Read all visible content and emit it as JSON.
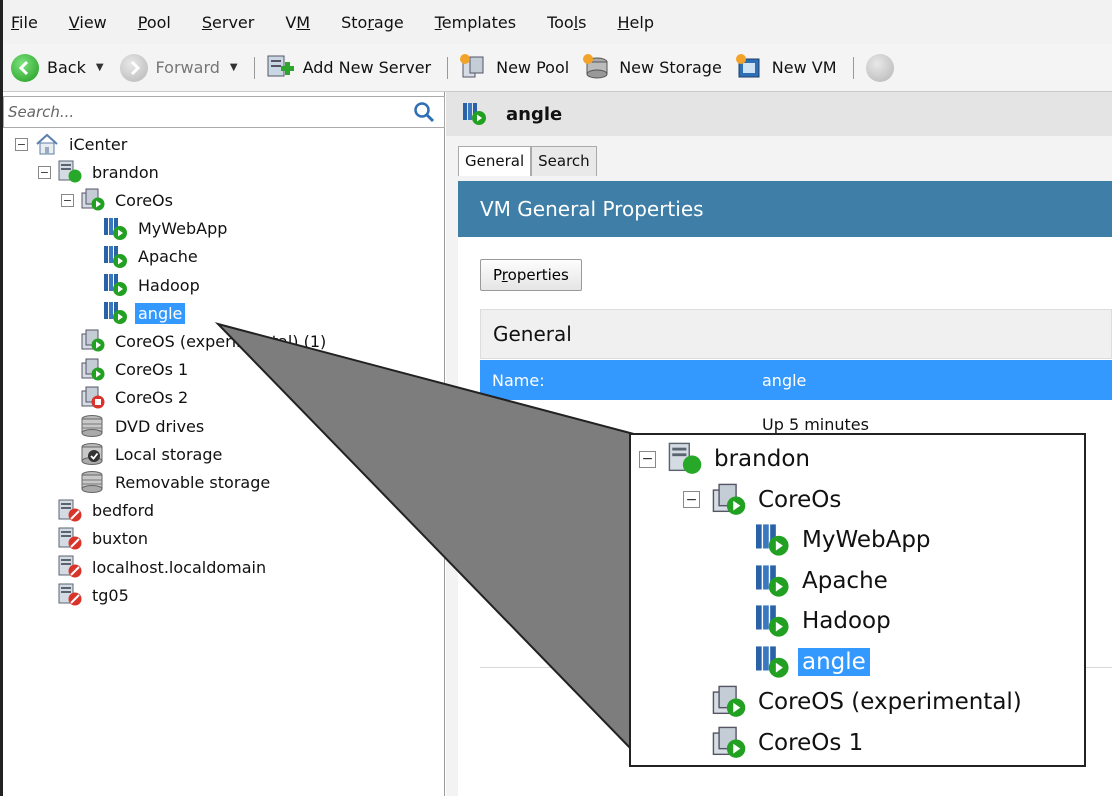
{
  "menu": [
    {
      "pre": "",
      "u": "F",
      "post": "ile"
    },
    {
      "pre": "",
      "u": "V",
      "post": "iew"
    },
    {
      "pre": "",
      "u": "P",
      "post": "ool"
    },
    {
      "pre": "",
      "u": "S",
      "post": "erver"
    },
    {
      "pre": "V",
      "u": "M",
      "post": ""
    },
    {
      "pre": "Sto",
      "u": "r",
      "post": "age"
    },
    {
      "pre": "",
      "u": "T",
      "post": "emplates"
    },
    {
      "pre": "Too",
      "u": "l",
      "post": "s"
    },
    {
      "pre": "",
      "u": "H",
      "post": "elp"
    }
  ],
  "toolbar": {
    "back": "Back",
    "forward": "Forward",
    "add_server": "Add New Server",
    "new_pool": "New Pool",
    "new_storage": "New Storage",
    "new_vm": "New VM"
  },
  "search": {
    "placeholder": "Search..."
  },
  "tree": [
    {
      "label": "iCenter",
      "level": 0,
      "exp": "−",
      "icon": "home-icon"
    },
    {
      "label": "brandon",
      "level": 1,
      "exp": "−",
      "icon": "server-running-icon"
    },
    {
      "label": "CoreOs",
      "level": 2,
      "exp": "−",
      "icon": "pool-running-icon"
    },
    {
      "label": "MyWebApp",
      "level": 3,
      "exp": "",
      "icon": "vm-running-icon"
    },
    {
      "label": "Apache",
      "level": 3,
      "exp": "",
      "icon": "vm-running-icon"
    },
    {
      "label": "Hadoop",
      "level": 3,
      "exp": "",
      "icon": "vm-running-icon"
    },
    {
      "label": "angle",
      "level": 3,
      "exp": "",
      "icon": "vm-running-icon",
      "selected": true
    },
    {
      "label": "CoreOS (experimental) (1)",
      "level": 2,
      "exp": "",
      "icon": "pool-running-icon"
    },
    {
      "label": "CoreOs 1",
      "level": 2,
      "exp": "",
      "icon": "pool-running-icon"
    },
    {
      "label": "CoreOs 2",
      "level": 2,
      "exp": "",
      "icon": "pool-stopped-icon"
    },
    {
      "label": "DVD drives",
      "level": 2,
      "exp": "",
      "icon": "storage-icon"
    },
    {
      "label": "Local storage",
      "level": 2,
      "exp": "",
      "icon": "local-storage-icon"
    },
    {
      "label": "Removable storage",
      "level": 2,
      "exp": "",
      "icon": "storage-icon"
    },
    {
      "label": "bedford",
      "level": 1,
      "exp": "",
      "icon": "server-disconnected-icon"
    },
    {
      "label": "buxton",
      "level": 1,
      "exp": "",
      "icon": "server-disconnected-icon"
    },
    {
      "label": "localhost.localdomain",
      "level": 1,
      "exp": "",
      "icon": "server-disconnected-icon"
    },
    {
      "label": "tg05",
      "level": 1,
      "exp": "",
      "icon": "server-disconnected-icon"
    }
  ],
  "header": {
    "title": "angle"
  },
  "tabs": [
    "General",
    "Search"
  ],
  "banner": "VM General Properties",
  "properties_button": {
    "pre": "P",
    "u": "r",
    "post": "operties"
  },
  "general": {
    "section": "General",
    "name_key": "Name:",
    "name_value": "angle",
    "uptime": "Up 5 minutes"
  },
  "zoom": [
    {
      "label": "brandon",
      "level": 0,
      "exp": "−",
      "icon": "server-running-icon"
    },
    {
      "label": "CoreOs",
      "level": 1,
      "exp": "−",
      "icon": "pool-running-icon"
    },
    {
      "label": "MyWebApp",
      "level": 2,
      "exp": "",
      "icon": "vm-running-icon"
    },
    {
      "label": "Apache",
      "level": 2,
      "exp": "",
      "icon": "vm-running-icon"
    },
    {
      "label": "Hadoop",
      "level": 2,
      "exp": "",
      "icon": "vm-running-icon"
    },
    {
      "label": "angle",
      "level": 2,
      "exp": "",
      "icon": "vm-running-icon",
      "selected": true
    },
    {
      "label": "CoreOS (experimental)",
      "level": 1,
      "exp": "",
      "icon": "pool-running-icon"
    },
    {
      "label": "CoreOs 1",
      "level": 1,
      "exp": "",
      "icon": "pool-running-icon"
    }
  ]
}
